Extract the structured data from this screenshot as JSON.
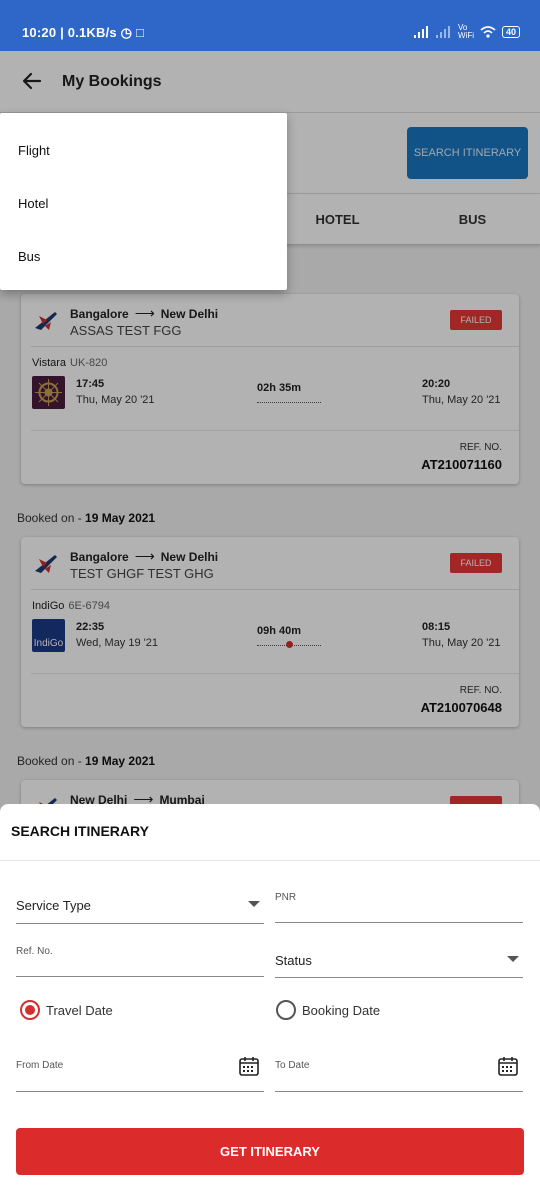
{
  "statusbar": {
    "time": "10:20",
    "speed": "0.1KB/s",
    "battery": "40"
  },
  "appbar": {
    "title": "My Bookings"
  },
  "filter": {
    "search_label": "SEARCH ITINERARY"
  },
  "tabs": [
    {
      "label": "HOTEL"
    },
    {
      "label": "BUS"
    }
  ],
  "menu": {
    "items": [
      {
        "label": "Flight"
      },
      {
        "label": "Hotel"
      },
      {
        "label": "Bus"
      }
    ]
  },
  "bookings": [
    {
      "booked_on_prefix": "Booked on - ",
      "booked_on": "",
      "from": "Bangalore",
      "to": "New Delhi",
      "passenger": "ASSAS TEST FGG",
      "status": "FAILED",
      "airline": "Vistara",
      "flight_no": "UK-820",
      "dep_time": "17:45",
      "dep_date": "Thu, May 20 '21",
      "duration": "02h 35m",
      "arr_time": "20:20",
      "arr_date": "Thu, May 20 '21",
      "ref_label": "REF. NO.",
      "ref_no": "AT210071160"
    },
    {
      "booked_on_prefix": "Booked on - ",
      "booked_on": "19 May 2021",
      "from": "Bangalore",
      "to": "New Delhi",
      "passenger": "TEST GHGF TEST GHG",
      "status": "FAILED",
      "airline": "IndiGo",
      "flight_no": "6E-6794",
      "logo_text": "IndiGo",
      "dep_time": "22:35",
      "dep_date": "Wed, May 19 '21",
      "duration": "09h 40m",
      "arr_time": "08:15",
      "arr_date": "Thu, May 20 '21",
      "ref_label": "REF. NO.",
      "ref_no": "AT210070648"
    },
    {
      "booked_on_prefix": "Booked on - ",
      "booked_on": "19 May 2021",
      "from": "New Delhi",
      "to": "Mumbai"
    }
  ],
  "sheet": {
    "title": "SEARCH ITINERARY",
    "service_type": "Service Type",
    "pnr": "PNR",
    "ref_no": "Ref. No.",
    "status": "Status",
    "travel_date": "Travel Date",
    "booking_date": "Booking Date",
    "from_date": "From Date",
    "to_date": "To Date",
    "get_button": "GET ITINERARY"
  },
  "colors": {
    "accent": "#dc2b2b",
    "status_bar": "#2f67c8",
    "search_button": "#1a78c2"
  }
}
